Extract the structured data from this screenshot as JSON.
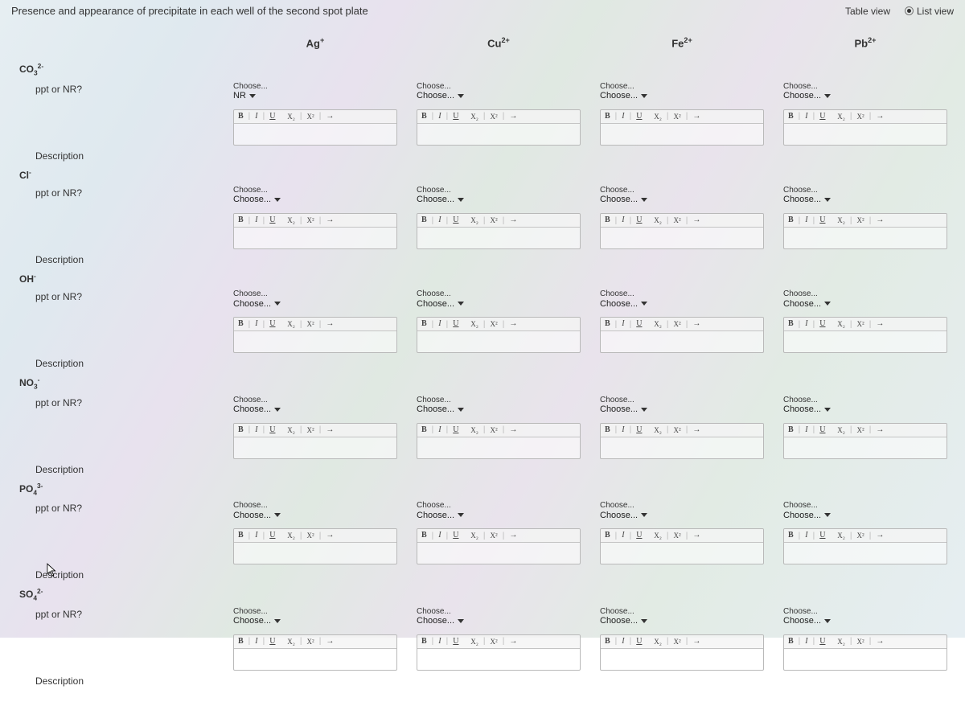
{
  "header": {
    "title": "Presence and appearance of precipitate in each well of the second spot plate",
    "view_table": "Table view",
    "view_list": "List view",
    "selected_view": "list"
  },
  "columns": [
    {
      "key": "ag",
      "html": "Ag<sup class='small'>+</sup>"
    },
    {
      "key": "cu",
      "html": "Cu<sup class='small'>2+</sup>"
    },
    {
      "key": "fe",
      "html": "Fe<sup class='small'>2+</sup>"
    },
    {
      "key": "pb",
      "html": "Pb<sup class='small'>2+</sup>"
    }
  ],
  "row_labels": {
    "ppt": "ppt or NR?",
    "desc": "Description"
  },
  "choose": {
    "label": "Choose...",
    "placeholder": "Choose..."
  },
  "toolbar": {
    "b": "B",
    "i": "I",
    "u": "U",
    "sub": "X₂",
    "sup": "X²",
    "arrow": "→",
    "sep": "|"
  },
  "anions": [
    {
      "id": "co3",
      "html": "CO<sub class='small'>3</sub><sup class='small'>2-</sup>",
      "cells": [
        {
          "selected": "NR"
        },
        {
          "selected": "Choose..."
        },
        {
          "selected": "Choose..."
        },
        {
          "selected": "Choose..."
        }
      ]
    },
    {
      "id": "cl",
      "html": "Cl<sup class='small'>-</sup>",
      "cells": [
        {
          "selected": "Choose..."
        },
        {
          "selected": "Choose..."
        },
        {
          "selected": "Choose..."
        },
        {
          "selected": "Choose..."
        }
      ]
    },
    {
      "id": "oh",
      "html": "OH<sup class='small'>-</sup>",
      "cells": [
        {
          "selected": "Choose..."
        },
        {
          "selected": "Choose..."
        },
        {
          "selected": "Choose..."
        },
        {
          "selected": "Choose..."
        }
      ]
    },
    {
      "id": "no3",
      "html": "NO<sub class='small'>3</sub><sup class='small'>-</sup>",
      "cells": [
        {
          "selected": "Choose..."
        },
        {
          "selected": "Choose..."
        },
        {
          "selected": "Choose..."
        },
        {
          "selected": "Choose..."
        }
      ]
    },
    {
      "id": "po4",
      "html": "PO<sub class='small'>4</sub><sup class='small'>3-</sup>",
      "cells": [
        {
          "selected": "Choose..."
        },
        {
          "selected": "Choose..."
        },
        {
          "selected": "Choose..."
        },
        {
          "selected": "Choose..."
        }
      ]
    },
    {
      "id": "so4",
      "html": "SO<sub class='small'>4</sub><sup class='small'>2-</sup>",
      "cells": [
        {
          "selected": "Choose..."
        },
        {
          "selected": "Choose..."
        },
        {
          "selected": "Choose..."
        },
        {
          "selected": "Choose..."
        }
      ]
    }
  ]
}
